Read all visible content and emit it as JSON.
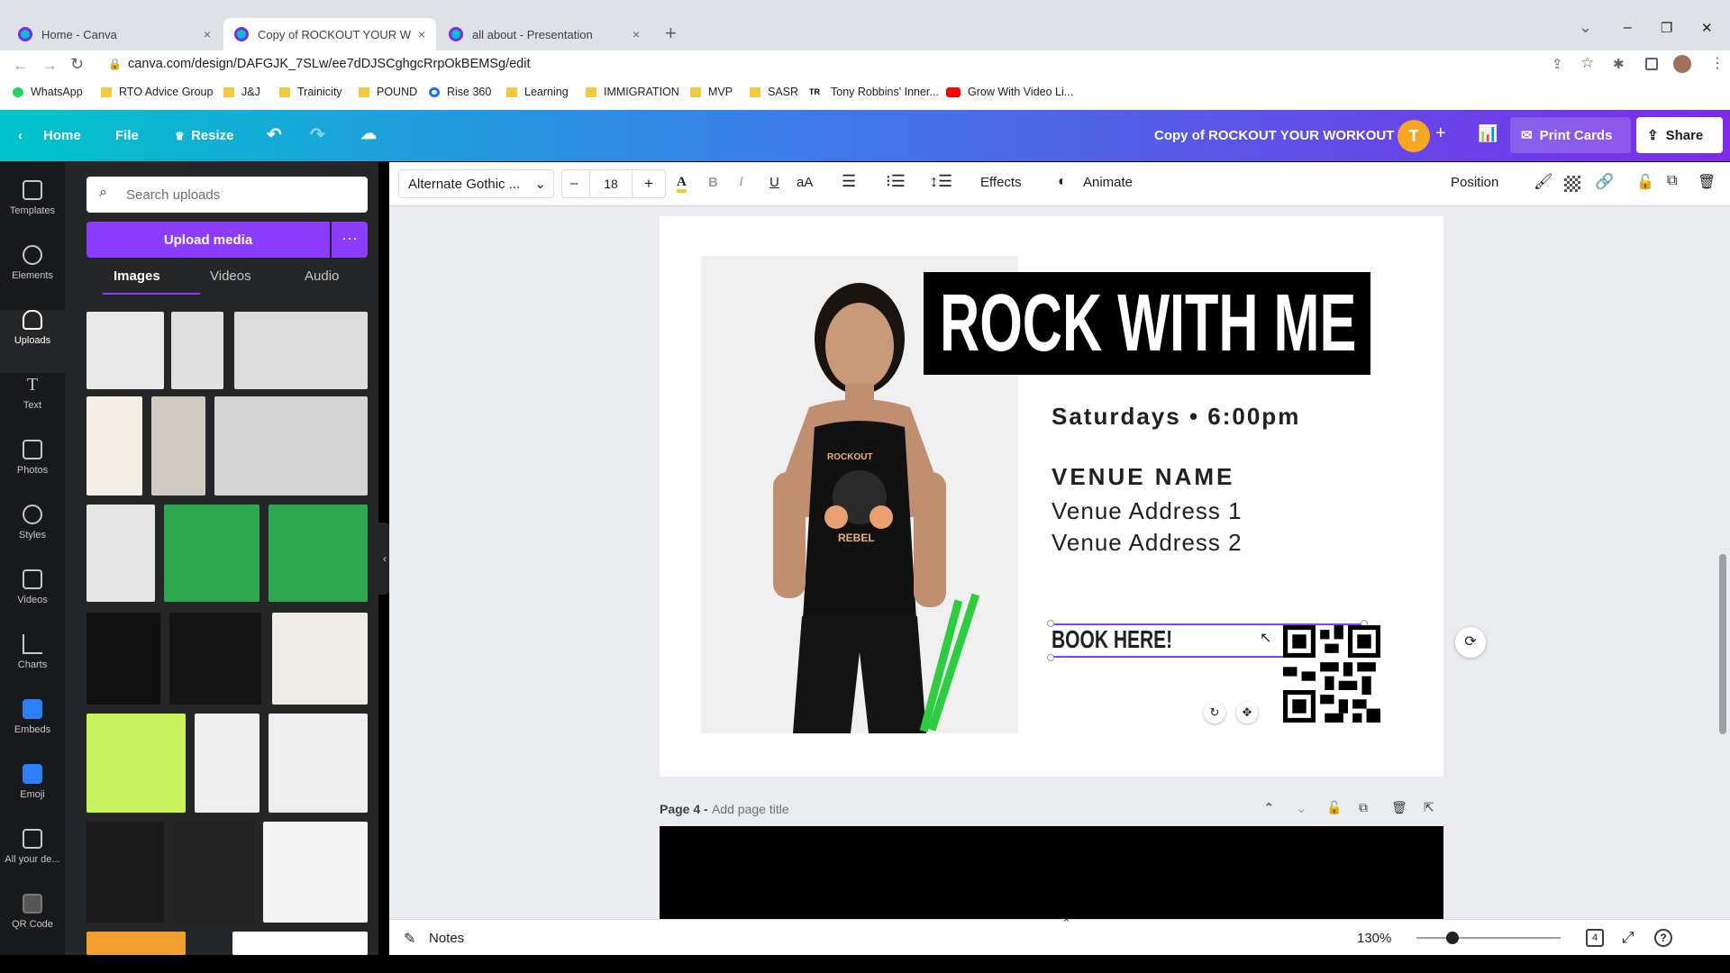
{
  "tabs": [
    {
      "label": "Home - Canva",
      "close": "×"
    },
    {
      "label": "Copy of ROCKOUT YOUR WORK",
      "close": "×"
    },
    {
      "label": "all about - Presentation",
      "close": "×"
    }
  ],
  "new_tab": "+",
  "window_controls": {
    "dropdown": "⌄",
    "minimize": "–",
    "restore": "❐",
    "close": "✕"
  },
  "address": {
    "url": "canva.com/design/DAFGJK_7SLw/ee7dDJSCghgcRrpOkBEMSg/edit"
  },
  "bookmarks": [
    "WhatsApp",
    "RTO Advice Group",
    "J&J",
    "Trainicity",
    "POUND",
    "Rise 360",
    "Learning",
    "IMMIGRATION",
    "MVP",
    "SASR",
    "Tony Robbins' Inner...",
    "Grow With Video Li..."
  ],
  "canva_bar": {
    "home": "Home",
    "file": "File",
    "resize": "Resize",
    "doc_title": "Copy of ROCKOUT YOUR WORKOUT",
    "avatar_letter": "T",
    "print": "Print Cards",
    "share": "Share"
  },
  "rail": [
    "Templates",
    "Elements",
    "Uploads",
    "Text",
    "Photos",
    "Styles",
    "Videos",
    "Charts",
    "Embeds",
    "Emoji",
    "All your de...",
    "QR Code"
  ],
  "panel": {
    "search_placeholder": "Search uploads",
    "upload": "Upload media",
    "more": "···",
    "tabs": [
      "Images",
      "Videos",
      "Audio"
    ]
  },
  "toolbar": {
    "font": "Alternate Gothic ...",
    "size": "18",
    "minus": "–",
    "plus": "+",
    "effects": "Effects",
    "animate": "Animate",
    "position": "Position"
  },
  "design": {
    "headline": "ROCK WITH ME",
    "time": "Saturdays • 6:00pm",
    "venue": "VENUE NAME",
    "address1": "Venue Address 1",
    "address2": "Venue Address 2",
    "cta": "BOOK HERE!",
    "shirt_line1": "ROCKOUT",
    "shirt_line2": "REBEL"
  },
  "page4": {
    "label": "Page 4 -",
    "placeholder": "Add page title"
  },
  "footer": {
    "notes": "Notes",
    "zoom": "130%",
    "page_count": "4",
    "help": "?",
    "zoom_fill": 0.25
  }
}
